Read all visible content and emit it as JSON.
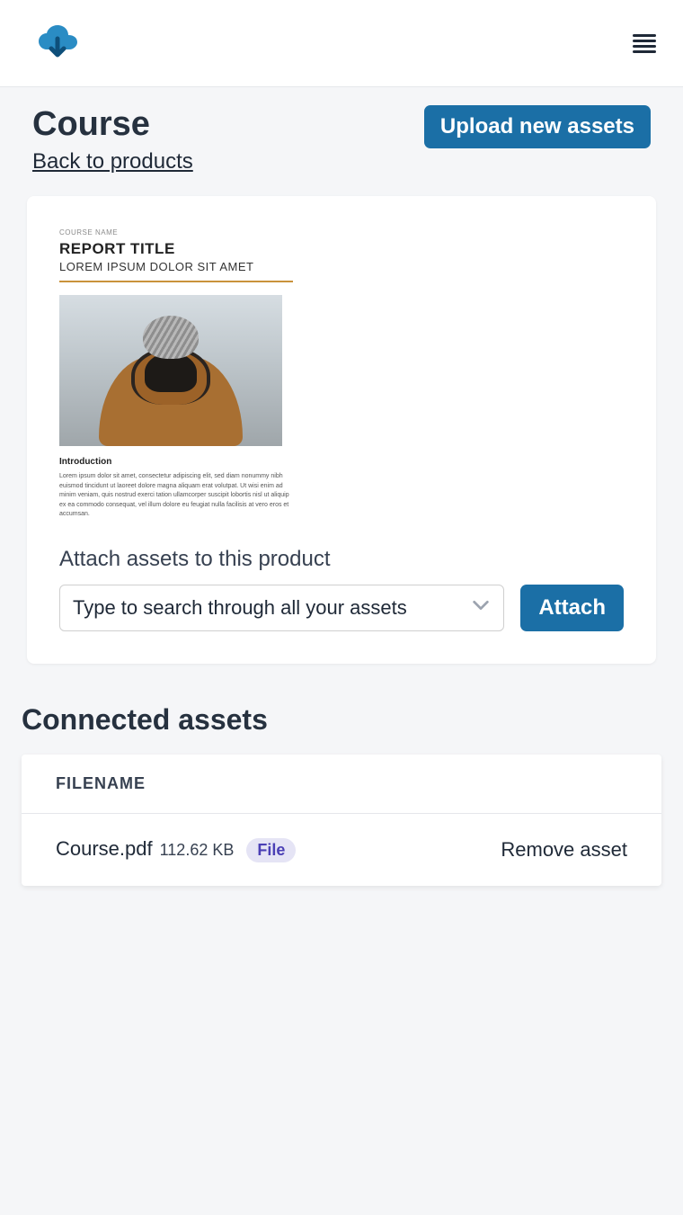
{
  "header": {
    "title": "Course",
    "back_link": "Back to products",
    "upload_button": "Upload new assets"
  },
  "preview": {
    "meta": "COURSE NAME",
    "title": "REPORT TITLE",
    "subtitle": "LOREM IPSUM DOLOR SIT AMET",
    "intro_heading": "Introduction",
    "intro_body": "Lorem ipsum dolor sit amet, consectetur adipiscing elit, sed diam nonummy nibh euismod tincidunt ut laoreet dolore magna aliquam erat volutpat. Ut wisi enim ad minim veniam, quis nostrud exerci tation ullamcorper suscipit lobortis nisl ut aliquip ex ea commodo consequat, vel illum dolore eu feugiat nulla facilisis at vero eros et accumsan."
  },
  "attach": {
    "label": "Attach assets to this product",
    "search_placeholder": "Type to search through all your assets",
    "attach_button": "Attach"
  },
  "connected": {
    "title": "Connected assets",
    "columns": {
      "filename": "FILENAME"
    },
    "rows": [
      {
        "filename": "Course.pdf",
        "size": "112.62 KB",
        "badge": "File",
        "action": "Remove asset"
      }
    ]
  }
}
